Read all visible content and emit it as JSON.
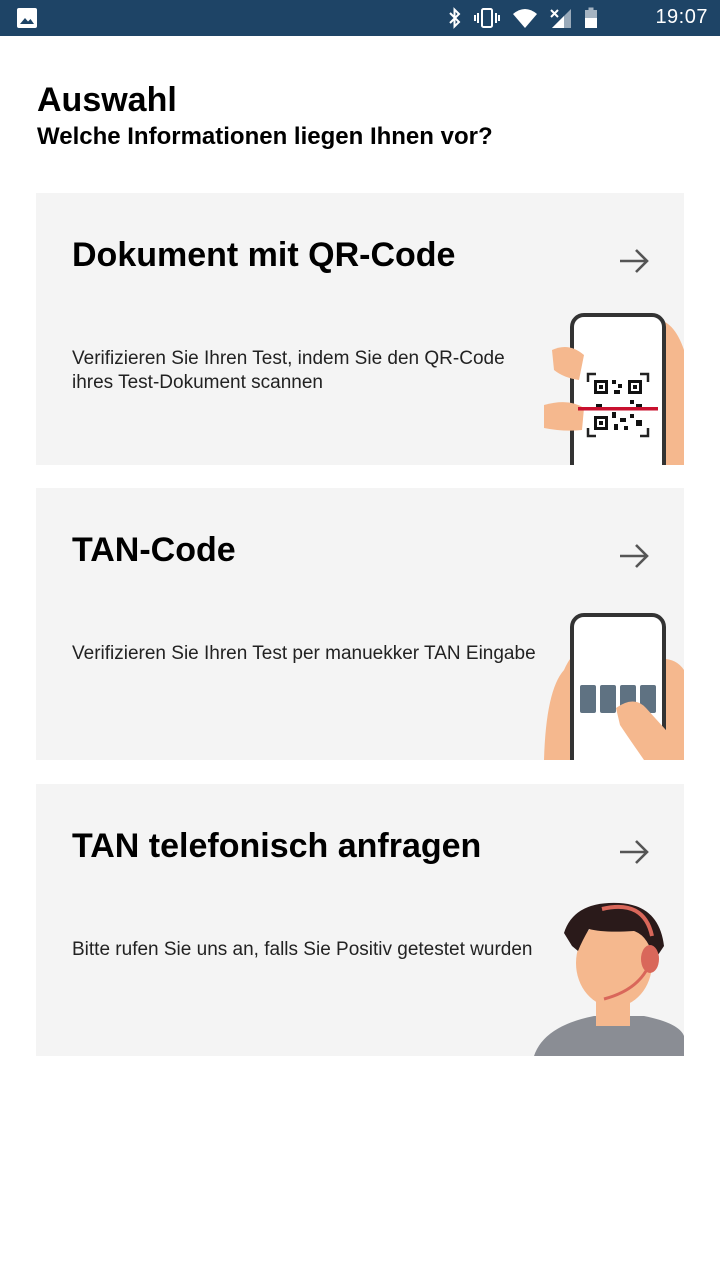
{
  "status_bar": {
    "time": "19:07",
    "icons": [
      "image-icon",
      "bluetooth-icon",
      "vibrate-icon",
      "wifi-icon",
      "signal-icon",
      "battery-icon"
    ]
  },
  "header": {
    "title": "Auswahl",
    "subtitle": "Welche Informationen liegen Ihnen vor?"
  },
  "options": [
    {
      "title": "Dokument mit QR-Code",
      "description": "Verifizieren Sie Ihren Test, indem Sie den QR-Code ihres Test-Dokument scannen",
      "icon": "qr-scan-phone-illustration"
    },
    {
      "title": "TAN-Code",
      "description": "Verifizieren Sie Ihren Test per manuekker TAN Eingabe",
      "icon": "tan-phone-illustration"
    },
    {
      "title": "TAN telefonisch anfragen",
      "description": "Bitte rufen Sie uns an, falls Sie Positiv getestet wurden",
      "icon": "hotline-agent-illustration"
    }
  ],
  "colors": {
    "status_bar": "#1e4466",
    "card_background": "#f4f4f4",
    "skin": "#f5b88e",
    "scan_line": "#c8102e",
    "tan_boxes": "#5f7282",
    "headset": "#d9675a",
    "hair": "#2a1a1a",
    "shirt": "#8a8d94"
  }
}
